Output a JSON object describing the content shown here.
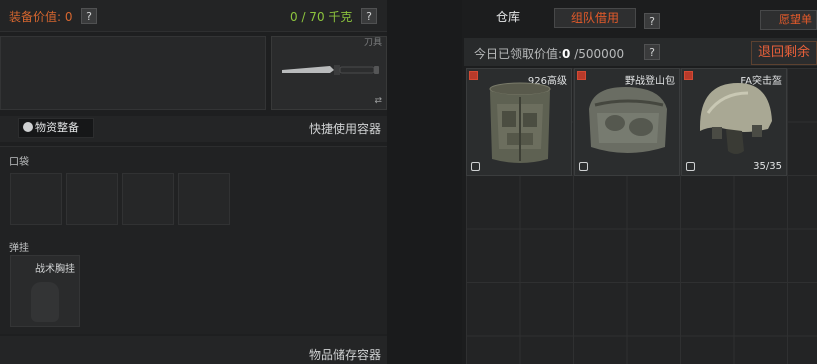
{
  "left": {
    "equip_value_label": "装备价值: 0",
    "weight_label": "0 / 70 千克",
    "help_glyph": "?",
    "knife_slot_label": "刀具",
    "organize_button": "物资整备",
    "quick_container_label": "快捷使用容器",
    "pocket_label": "口袋",
    "ammo_label": "弹挂",
    "rig_name": "战术胸挂",
    "storage_container_label": "物品储存容器",
    "swap_glyph": "⇄"
  },
  "right": {
    "tab_warehouse": "仓库",
    "tab_team_borrow": "组队借用",
    "wishlist_label": "愿望单",
    "claim_text_prefix": "今日已领取价值:",
    "claim_value": "0",
    "claim_limit": "/500000",
    "return_button": "退回剩余",
    "items": [
      {
        "name": "926高级",
        "kind": "backpack-large",
        "durability": ""
      },
      {
        "name": "野战登山包",
        "kind": "backpack-field",
        "durability": ""
      },
      {
        "name": "FA突击盔",
        "kind": "helmet",
        "durability": "35/35"
      }
    ]
  },
  "colors": {
    "accent_orange": "#e35a2a",
    "weight_green": "#8cc43d",
    "rarity_red": "#b83a2a"
  }
}
